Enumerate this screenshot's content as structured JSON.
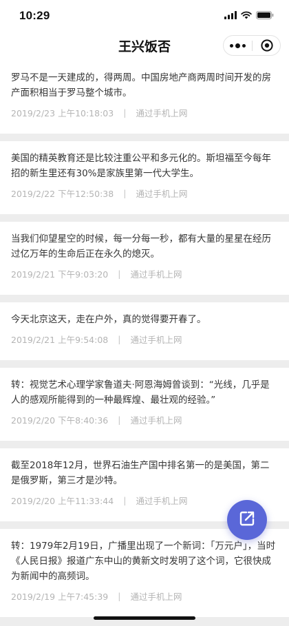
{
  "status_bar": {
    "time": "10:29",
    "icons": [
      "signal-icon",
      "wifi-icon",
      "battery-icon"
    ]
  },
  "header": {
    "title": "王兴饭否",
    "more_icon": "more-dots-icon",
    "close_icon": "target-close-icon"
  },
  "posts": [
    {
      "text": "罗马不是一天建成的，得两周。中国房地产商两周时间开发的房产面积相当于罗马整个城市。",
      "time": "2019/2/23 上午10:18:03",
      "separator": "|",
      "source": "通过手机上网"
    },
    {
      "text": "美国的精英教育还是比较注重公平和多元化的。斯坦福至今每年招的新生里还有30%是家族里第一代大学生。",
      "time": "2019/2/22 下午12:50:38",
      "separator": "|",
      "source": "通过手机上网"
    },
    {
      "text": "当我们仰望星空的时候，每一分每一秒，都有大量的星星在经历过亿万年的生命后正在永久的熄灭。",
      "time": "2019/2/21 下午9:03:20",
      "separator": "|",
      "source": "通过手机上网"
    },
    {
      "text": "今天北京这天，走在户外，真的觉得要开春了。",
      "time": "2019/2/21 上午9:54:08",
      "separator": "|",
      "source": "通过手机上网"
    },
    {
      "text": "转：视觉艺术心理学家鲁道夫·阿恩海姆曾谈到：“光线，几乎是人的感观所能得到的一种最辉煌、最壮观的经验。”",
      "time": "2019/2/20 下午8:40:36",
      "separator": "|",
      "source": "通过手机上网"
    },
    {
      "text": "截至2018年12月，世界石油生产国中排名第一的是美国，第二是俄罗斯，第三才是沙特。",
      "time": "2019/2/20 上午11:33:44",
      "separator": "|",
      "source": "通过手机上网"
    },
    {
      "text": "转：1979年2月19日，广播里出现了一个新词：「万元户」，当时《人民日报》报道广东中山的黄新文时发明了这个词，它很快成为新闻中的高频词。",
      "time": "2019/2/19 上午7:45:39",
      "separator": "|",
      "source": "通过手机上网"
    }
  ],
  "fab": {
    "icon": "compose-icon",
    "color": "#5a67d8"
  },
  "colors": {
    "background": "#ededed",
    "card": "#ffffff",
    "text": "#353535",
    "meta": "#b4b4b4"
  }
}
